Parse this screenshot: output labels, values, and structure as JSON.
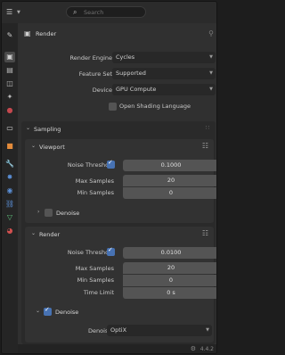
{
  "header": {
    "editor_icon": "☰",
    "search_placeholder": "Search",
    "search_icon": "⌕"
  },
  "tabs": [
    {
      "name": "tool-tab-icon",
      "glyph": "✎",
      "color": "#c9c9c9"
    },
    {
      "name": "render-tab-icon",
      "glyph": "▣",
      "color": "#d0d0d0",
      "active": true
    },
    {
      "name": "output-tab-icon",
      "glyph": "▤",
      "color": "#bbbbbb"
    },
    {
      "name": "view-layer-tab-icon",
      "glyph": "◫",
      "color": "#bbbbbb"
    },
    {
      "name": "scene-tab-icon",
      "glyph": "✦",
      "color": "#bbbbbb"
    },
    {
      "name": "world-tab-icon",
      "glyph": "●",
      "color": "#c4484e"
    },
    {
      "name": "collection-tab-icon",
      "glyph": "▭",
      "color": "#dddddd"
    },
    {
      "name": "object-tab-icon",
      "glyph": "■",
      "color": "#e38b3b"
    },
    {
      "name": "modifier-tab-icon",
      "glyph": "🔧",
      "color": "#5b8fd6"
    },
    {
      "name": "particles-tab-icon",
      "glyph": "✸",
      "color": "#5b8fd6"
    },
    {
      "name": "physics-tab-icon",
      "glyph": "◉",
      "color": "#5b8fd6"
    },
    {
      "name": "constraints-tab-icon",
      "glyph": "⛓",
      "color": "#5b8fd6"
    },
    {
      "name": "data-tab-icon",
      "glyph": "▽",
      "color": "#62c47e"
    },
    {
      "name": "material-tab-icon",
      "glyph": "◕",
      "color": "#d0504f"
    }
  ],
  "title": {
    "icon": "▣",
    "label": "Render",
    "pin": "⚲"
  },
  "render": {
    "engine_label": "Render Engine",
    "engine_value": "Cycles",
    "feature_set_label": "Feature Set",
    "feature_set_value": "Supported",
    "device_label": "Device",
    "device_value": "GPU Compute",
    "osl_label": "Open Shading Language",
    "osl_checked": false
  },
  "sampling": {
    "label": "Sampling",
    "viewport": {
      "label": "Viewport",
      "noise_threshold_label": "Noise Threshold",
      "noise_threshold_enabled": true,
      "noise_threshold_value": "0.1000",
      "max_samples_label": "Max Samples",
      "max_samples_value": "20",
      "min_samples_label": "Min Samples",
      "min_samples_value": "0",
      "denoise_label": "Denoise",
      "denoise_checked": false
    },
    "render": {
      "label": "Render",
      "noise_threshold_label": "Noise Threshold",
      "noise_threshold_enabled": true,
      "noise_threshold_value": "0.0100",
      "max_samples_label": "Max Samples",
      "max_samples_value": "20",
      "min_samples_label": "Min Samples",
      "min_samples_value": "0",
      "time_limit_label": "Time Limit",
      "time_limit_value": "0 s",
      "denoise_label": "Denoise",
      "denoise_checked": true,
      "denoiser_label": "Denoiser",
      "denoiser_value": "OptiX"
    }
  },
  "footer": {
    "version": "4.4.2"
  }
}
